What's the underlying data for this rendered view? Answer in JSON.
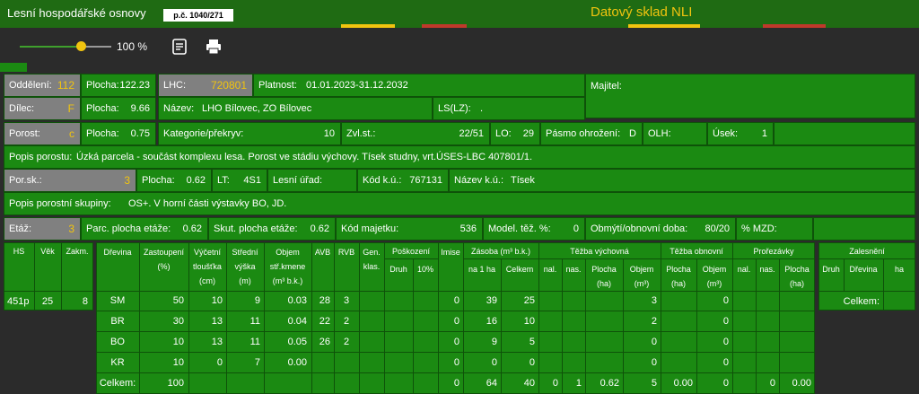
{
  "app": {
    "title": "Lesní hospodářské osnovy",
    "badge": "p.č. 1040/271",
    "right_title": "Datový sklad NLI",
    "zoom": "100 %"
  },
  "icons": {
    "notes": "notes-icon",
    "print": "print-icon"
  },
  "colors": {
    "bar_green": "#1f6b13",
    "cell_green": "#1b8a12",
    "accent": "#f1c40f",
    "gray": "#808080"
  },
  "row1": {
    "oddeleni_label": "Oddělení:",
    "oddeleni": "112",
    "plocha_label": "Plocha:",
    "plocha": "122.23",
    "lhc_label": "LHC:",
    "lhc": "720801",
    "platnost_label": "Platnost:",
    "platnost": "01.01.2023-31.12.2032",
    "majitel_label": "Majitel:"
  },
  "row2": {
    "dilec_label": "Dílec:",
    "dilec": "F",
    "plocha_label": "Plocha:",
    "plocha": "9.66",
    "nazev_label": "Název:",
    "nazev": "LHO Bílovec, ZO Bílovec",
    "ls_label": "LS(LZ):",
    "ls": "."
  },
  "row3": {
    "porost_label": "Porost:",
    "porost": "c",
    "plocha_label": "Plocha:",
    "plocha": "0.75",
    "kat_label": "Kategorie/překryv:",
    "kat": "10",
    "zvl_label": "Zvl.st.:",
    "zvl": "22/51",
    "lo_label": "LO:",
    "lo": "29",
    "pasmo_label": "Pásmo ohrožení:",
    "pasmo": "D",
    "olh_label": "OLH:",
    "usek_label": "Úsek:",
    "usek": "1"
  },
  "popis_porostu": {
    "label": "Popis porostu:",
    "text": "Úzká parcela - součást komplexu lesa. Porost ve stádiu výchovy. Tísek studny, vrt.ÚSES-LBC 407801/1."
  },
  "row5": {
    "porsk_label": "Por.sk.:",
    "porsk": "3",
    "plocha_label": "Plocha:",
    "plocha": "0.62",
    "lt_label": "LT:",
    "lt": "4S1",
    "urad_label": "Lesní úřad:",
    "kodku_label": "Kód k.ú.:",
    "kodku": "767131",
    "nazevku_label": "Název k.ú.:",
    "nazevku": "Tísek"
  },
  "popis_skupiny": {
    "label": "Popis porostní skupiny:",
    "text": "OS+. V horní části výstavky BO, JD."
  },
  "row7": {
    "etaz_label": "Etáž:",
    "etaz": "3",
    "parc_label": "Parc. plocha etáže:",
    "parc": "0.62",
    "skut_label": "Skut. plocha etáže:",
    "skut": "0.62",
    "kod_label": "Kód majetku:",
    "kod": "536",
    "model_label": "Model. těž. %:",
    "model": "0",
    "obmyti_label": "Obmýtí/obnovní doba:",
    "obmyti": "80/20",
    "mzd_label": "% MZD:"
  },
  "left_table": {
    "headers": [
      "HS",
      "Věk",
      "Zakm."
    ],
    "values": [
      "451p",
      "25",
      "8"
    ]
  },
  "main_table": {
    "h_drevina": "Dřevina",
    "h_zast": "Zastoupení",
    "h_zast2": "(%)",
    "h_vyc": "Výčetní",
    "h_vyc2": "tloušťka",
    "h_vyc3": "(cm)",
    "h_str": "Střední",
    "h_str2": "výška",
    "h_str3": "(m)",
    "h_obj": "Objem",
    "h_obj2": "stř.kmene",
    "h_obj3": "(m³ b.k.)",
    "h_avb": "AVB",
    "h_rvb": "RVB",
    "h_gen": "Gen.",
    "h_gen2": "klas.",
    "h_posk": "Poškození",
    "h_druh": "Druh",
    "h_10": "10%",
    "h_imise": "Imise",
    "h_zasoba": "Zásoba (m³ b.k.)",
    "h_na1ha": "na 1 ha",
    "h_celkem": "Celkem",
    "h_tv": "Těžba výchovná",
    "h_nal": "nal.",
    "h_nas": "nas.",
    "h_plocha": "Plocha",
    "h_ha": "(ha)",
    "h_objem": "Objem",
    "h_m3": "(m³)",
    "h_to": "Těžba obnovní",
    "h_proreza": "Prořezávky",
    "rows": [
      {
        "dr": "SM",
        "zast": "50",
        "vyc": "10",
        "str": "9",
        "obj": "0.03",
        "avb": "28",
        "rvb": "3",
        "imise": "0",
        "na1ha": "39",
        "celkem": "25",
        "tv_objem": "3",
        "to_objem": "0"
      },
      {
        "dr": "BR",
        "zast": "30",
        "vyc": "13",
        "str": "11",
        "obj": "0.04",
        "avb": "22",
        "rvb": "2",
        "imise": "0",
        "na1ha": "16",
        "celkem": "10",
        "tv_objem": "2",
        "to_objem": "0"
      },
      {
        "dr": "BO",
        "zast": "10",
        "vyc": "13",
        "str": "11",
        "obj": "0.05",
        "avb": "26",
        "rvb": "2",
        "imise": "0",
        "na1ha": "9",
        "celkem": "5",
        "tv_objem": "0",
        "to_objem": "0"
      },
      {
        "dr": "KR",
        "zast": "10",
        "vyc": "0",
        "str": "7",
        "obj": "0.00",
        "avb": "",
        "rvb": "",
        "imise": "0",
        "na1ha": "0",
        "celkem": "0",
        "tv_objem": "0",
        "to_objem": "0"
      }
    ],
    "total": {
      "label": "Celkem:",
      "zast": "100",
      "imise": "0",
      "na1ha": "64",
      "celkem": "40",
      "tv_nal": "0",
      "tv_nas": "1",
      "tv_plocha": "0.62",
      "tv_objem": "5",
      "to_plocha": "0.00",
      "to_objem": "0",
      "pr_nas": "0",
      "pr_plocha": "0.00"
    }
  },
  "zalesneni": {
    "title": "Zalesnění",
    "druh": "Druh",
    "drevina": "Dřevina",
    "ha": "ha",
    "celkem": "Celkem:"
  }
}
